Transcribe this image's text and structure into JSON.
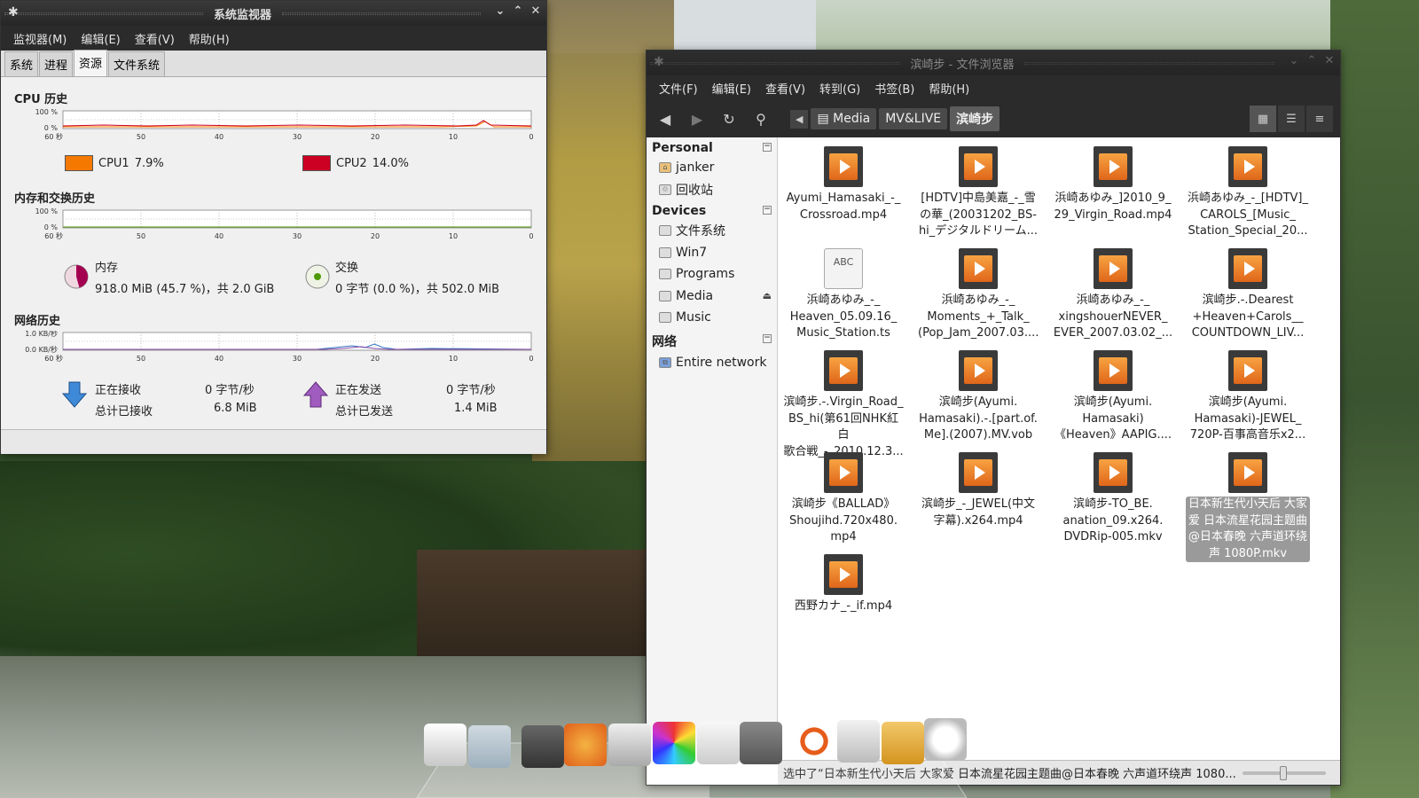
{
  "sysmon": {
    "title": "系统监视器",
    "menu": [
      "监视器(M)",
      "编辑(E)",
      "查看(V)",
      "帮助(H)"
    ],
    "tabs": [
      "系统",
      "进程",
      "资源",
      "文件系统"
    ],
    "active_tab": 2,
    "cpu": {
      "section": "CPU 历史",
      "y_top": "100 %",
      "y_bottom": "0 %",
      "x_ticks": [
        "60 秒",
        "50",
        "40",
        "30",
        "20",
        "10",
        "0"
      ],
      "legend": [
        {
          "label": "CPU1",
          "value": "7.9%",
          "color": "#f57900"
        },
        {
          "label": "CPU2",
          "value": "14.0%",
          "color": "#cc0022"
        }
      ]
    },
    "mem": {
      "section": "内存和交换历史",
      "y_top": "100 %",
      "y_bottom": "0 %",
      "x_ticks": [
        "60 秒",
        "50",
        "40",
        "30",
        "20",
        "10",
        "0"
      ],
      "memory_label": "内存",
      "memory_value": "918.0 MiB (45.7 %)，共 2.0 GiB",
      "memory_fraction": 0.457,
      "memory_color": "#a40050",
      "swap_label": "交换",
      "swap_value": "0 字节 (0.0 %)，共 502.0 MiB",
      "swap_color": "#4e9a06"
    },
    "net": {
      "section": "网络历史",
      "y_top": "1.0 KB/秒",
      "y_bottom": "0.0 KB/秒",
      "x_ticks": [
        "60 秒",
        "50",
        "40",
        "30",
        "20",
        "10",
        "0"
      ],
      "recv_label": "正在接收",
      "recv_rate": "0 字节/秒",
      "recv_total_label": "总计已接收",
      "recv_total": "6.8 MiB",
      "send_label": "正在发送",
      "send_rate": "0 字节/秒",
      "send_total_label": "总计已发送",
      "send_total": "1.4 MiB",
      "recv_color": "#2e74c0",
      "send_color": "#8a4aa8"
    }
  },
  "fb": {
    "title": "滨崎步 - 文件浏览器",
    "menu": [
      "文件(F)",
      "编辑(E)",
      "查看(V)",
      "转到(G)",
      "书签(B)",
      "帮助(H)"
    ],
    "crumbs": [
      "Media",
      "MV&LIVE",
      "滨崎步"
    ],
    "sidebar": {
      "personal": "Personal",
      "personal_items": [
        "janker",
        "回收站"
      ],
      "devices": "Devices",
      "device_items": [
        "文件系统",
        "Win7",
        "Programs",
        "Media",
        "Music"
      ],
      "network": "网络",
      "network_items": [
        "Entire network"
      ]
    },
    "files": [
      {
        "type": "video",
        "name": "Ayumi_Hamasaki_-_\nCrossroad.mp4"
      },
      {
        "type": "video",
        "name": "[HDTV]中島美嘉_-_雪\nの華_(20031202_BS-\nhi_デジタルドリーム..."
      },
      {
        "type": "video",
        "name": "浜崎あゆみ_]2010_9_\n29_Virgin_Road.mp4"
      },
      {
        "type": "video",
        "name": "浜崎あゆみ_-_[HDTV]_\nCAROLS_[Music_\nStation_Special_20..."
      },
      {
        "type": "text",
        "icon_text": "ABC",
        "name": "浜崎あゆみ_-_\nHeaven_05.09.16_\nMusic_Station.ts"
      },
      {
        "type": "video",
        "name": "浜崎あゆみ_-_\nMoments_+_Talk_\n(Pop_Jam_2007.03...."
      },
      {
        "type": "video",
        "name": "浜崎あゆみ_-_\nxingshouerNEVER_\nEVER_2007.03.02_..."
      },
      {
        "type": "video",
        "name": "滨崎步.-.Dearest\n+Heaven+Carols__\nCOUNTDOWN_LIV..."
      },
      {
        "type": "video",
        "name": "滨崎步.-.Virgin_Road_\nBS_hi(第61回NHK紅白\n歌合戦_-_2010.12.3..."
      },
      {
        "type": "video",
        "name": "滨崎步(Ayumi.\nHamasaki).-.[part.of.\nMe].(2007).MV.vob"
      },
      {
        "type": "video",
        "name": "滨崎步(Ayumi.\nHamasaki)\n《Heaven》AAPIG...."
      },
      {
        "type": "video",
        "name": "滨崎步(Ayumi.\nHamasaki)-JEWEL_\n720P-百事高音乐x2..."
      },
      {
        "type": "video",
        "name": "滨崎步《BALLAD》\nShoujihd.720x480.\nmp4"
      },
      {
        "type": "video",
        "name": "滨崎步_-_JEWEL(中文\n字幕).x264.mp4"
      },
      {
        "type": "video",
        "name": "滨崎步-TO_BE.\nanation_09.x264.\nDVDRip-005.mkv"
      },
      {
        "type": "video",
        "selected": true,
        "name": "日本新生代小天后 大家\n爱 日本流星花园主题曲\n@日本春晚 六声道环绕\n声 1080P.mkv"
      },
      {
        "type": "video",
        "name": "西野カナ_-_if.mp4"
      }
    ],
    "status": "选中了“日本新生代小天后 大家爱 日本流星花园主题曲@日本春晚 六声道环绕声 1080..."
  },
  "icons": {
    "back": "back-arrow-icon",
    "forward": "forward-arrow-icon",
    "reload": "reload-icon",
    "search": "search-icon"
  }
}
